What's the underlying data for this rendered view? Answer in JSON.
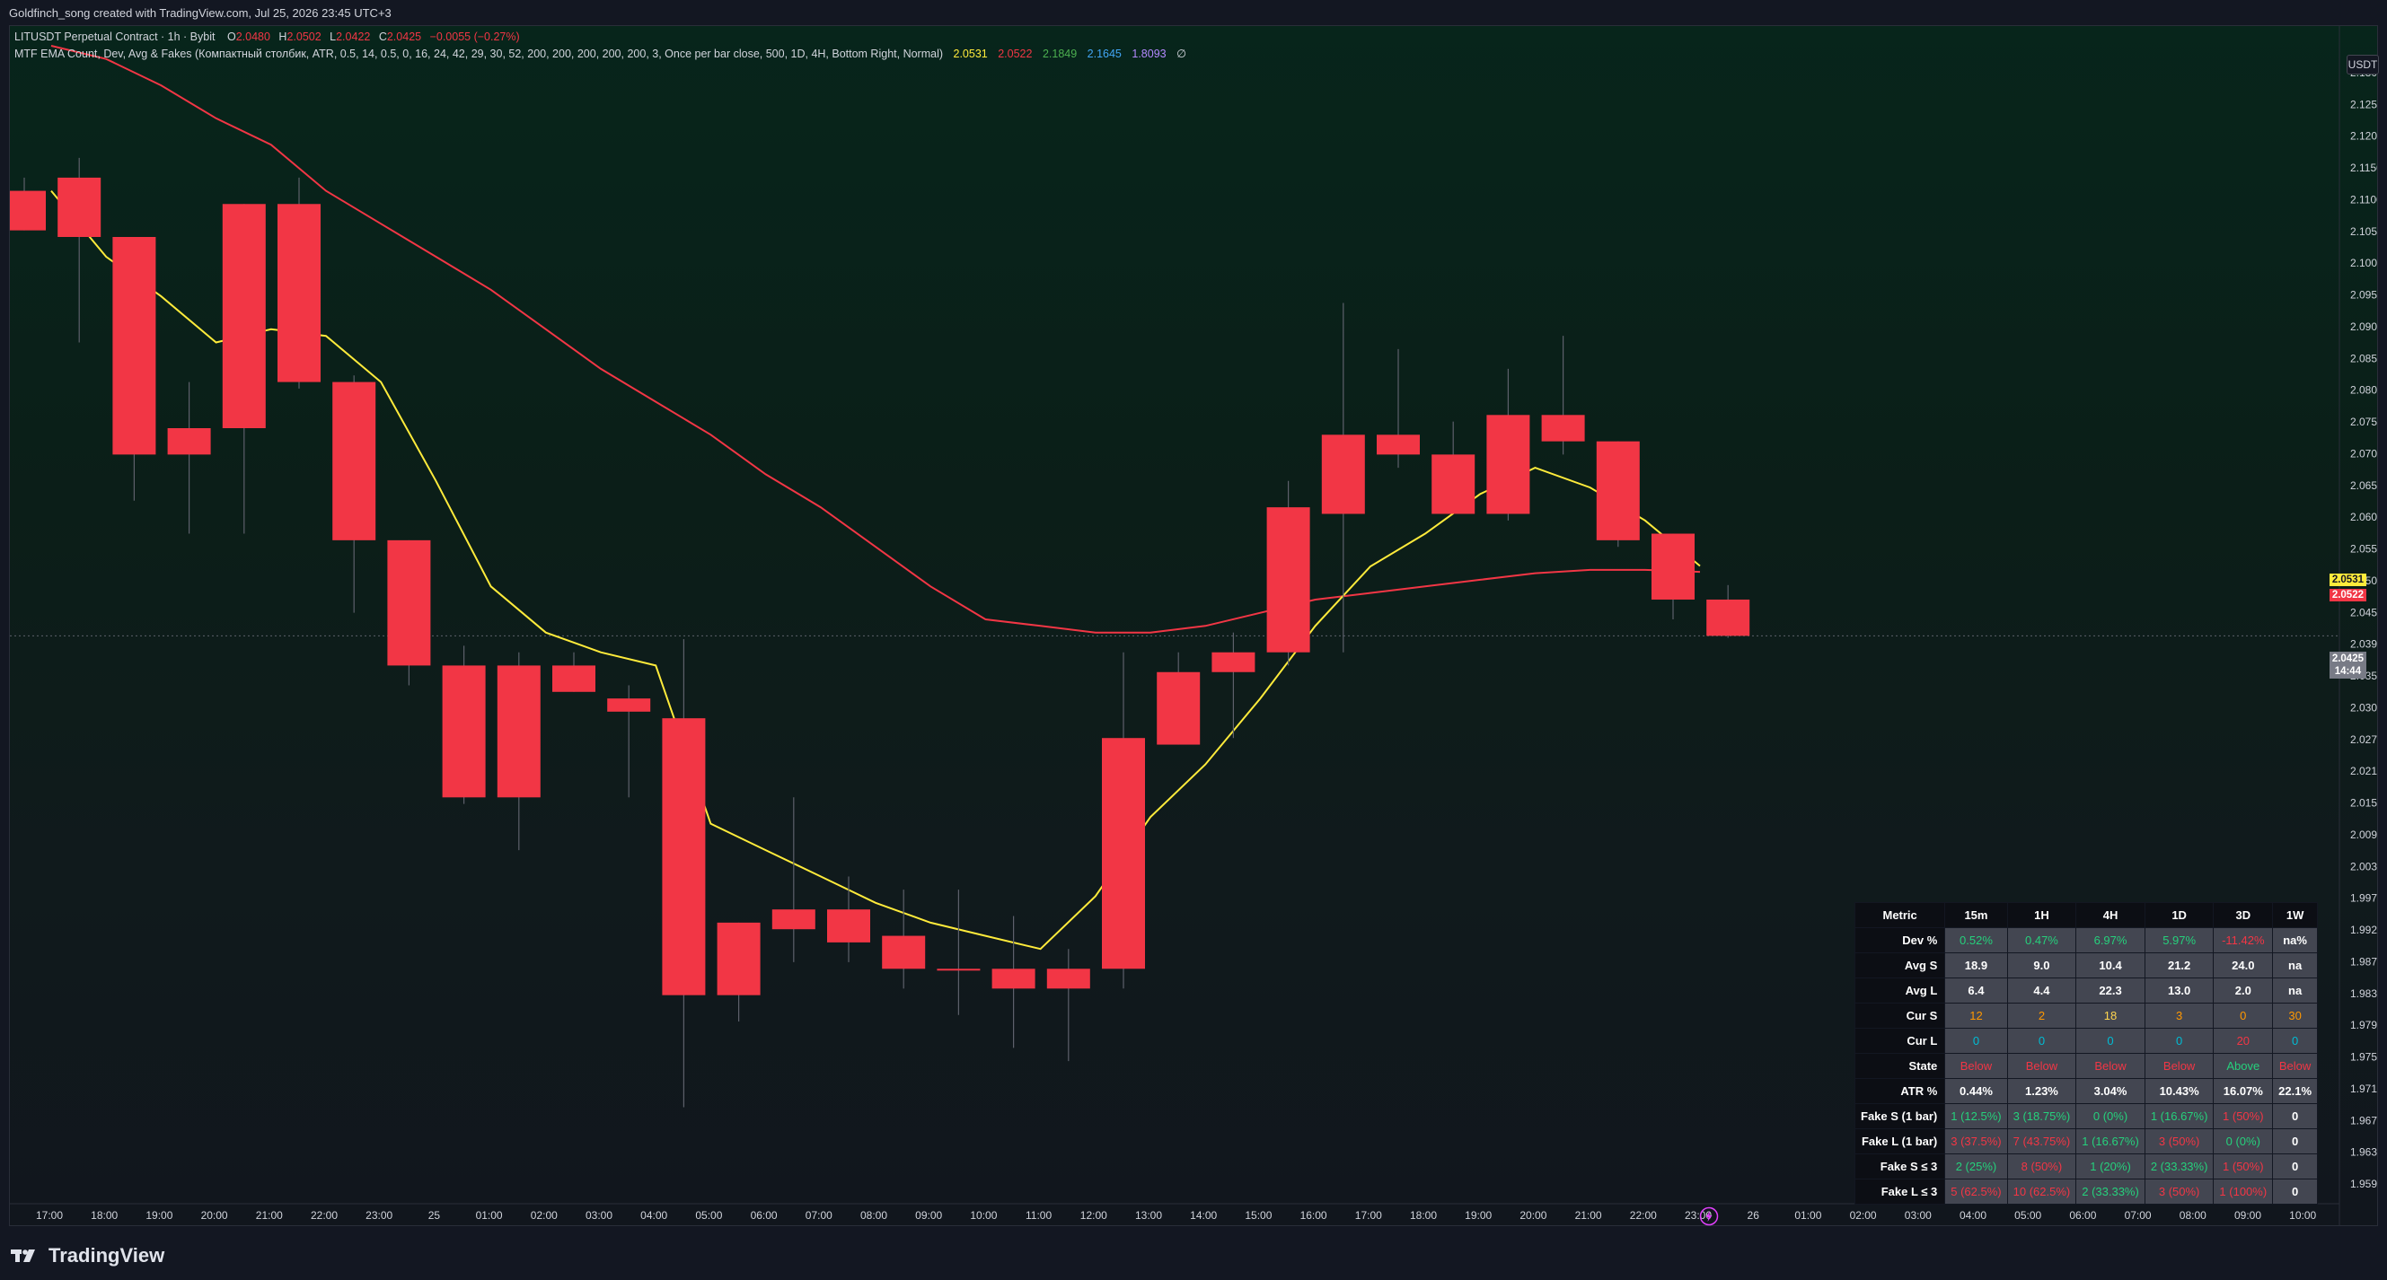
{
  "header": {
    "created_text": "Goldfinch_song created with TradingView.com, Jul 25, 2026 23:45 UTC+3"
  },
  "legend": {
    "symbol": "LITUSDT Perpetual Contract · 1h · Bybit",
    "o_label": "O",
    "o_value": "2.0480",
    "h_label": "H",
    "h_value": "2.0502",
    "l_label": "L",
    "l_value": "2.0422",
    "c_label": "C",
    "c_value": "2.0425",
    "change": "−0.0055 (−0.27%)",
    "indicator": "MTF EMA Count, Dev, Avg & Fakes (Компактный столбик, ATR, 0.5, 14, 0.5, 0, 16, 24, 42, 29, 30, 52, 200, 200, 200, 200, 200, 3, Once per bar close, 500, 1D, 4H, Bottom Right, Normal)",
    "values": [
      "2.0531",
      "2.0522",
      "2.1849",
      "2.1645",
      "1.8093",
      "∅"
    ],
    "value_colors": [
      "#ffeb3b",
      "#f23645",
      "#4caf50",
      "#42a5f5",
      "#b388ff",
      "#d1d4dc"
    ]
  },
  "price_axis": {
    "currency": "USDT",
    "labels": [
      "2.1300",
      "2.1250",
      "2.1200",
      "2.1150",
      "2.1100",
      "2.1050",
      "2.1000",
      "2.0950",
      "2.0900",
      "2.0850",
      "2.0800",
      "2.0750",
      "2.0700",
      "2.0650",
      "2.0600",
      "2.0550",
      "2.0500",
      "2.0450",
      "2.0390",
      "2.0350",
      "2.0300",
      "2.0270",
      "2.0210",
      "2.0150",
      "2.0090",
      "2.0030",
      "1.9970",
      "1.9920",
      "1.9870",
      "1.9830",
      "1.9790",
      "1.9750",
      "1.9710",
      "1.9670",
      "1.9630",
      "1.9590"
    ],
    "tag_yellow": "2.0531",
    "tag_red": "2.0522",
    "tag_last": "2.0425",
    "tag_countdown": "14:44"
  },
  "time_axis": {
    "labels": [
      "17:00",
      "18:00",
      "19:00",
      "20:00",
      "21:00",
      "22:00",
      "23:00",
      "25",
      "01:00",
      "02:00",
      "03:00",
      "04:00",
      "05:00",
      "06:00",
      "07:00",
      "08:00",
      "09:00",
      "10:00",
      "11:00",
      "12:00",
      "13:00",
      "14:00",
      "15:00",
      "16:00",
      "17:00",
      "18:00",
      "19:00",
      "20:00",
      "21:00",
      "22:00",
      "23:00",
      "26",
      "01:00",
      "02:00",
      "03:00",
      "04:00",
      "05:00",
      "06:00",
      "07:00",
      "08:00",
      "09:00",
      "10:00"
    ]
  },
  "chart_data": {
    "type": "candlestick",
    "interval": "1h",
    "ylim": [
      1.958,
      2.132
    ],
    "colors": {
      "up": "#f23645",
      "down": "#f23645",
      "ema_fast": "#ffeb3b",
      "ema_slow": "#f23645"
    },
    "candles": [
      {
        "o": 2.11,
        "h": 2.112,
        "l": 2.104,
        "c": 2.104
      },
      {
        "o": 2.112,
        "h": 2.115,
        "l": 2.087,
        "c": 2.103
      },
      {
        "o": 2.103,
        "h": 2.103,
        "l": 2.063,
        "c": 2.07
      },
      {
        "o": 2.07,
        "h": 2.081,
        "l": 2.058,
        "c": 2.074
      },
      {
        "o": 2.108,
        "h": 2.108,
        "l": 2.058,
        "c": 2.074
      },
      {
        "o": 2.108,
        "h": 2.112,
        "l": 2.08,
        "c": 2.081
      },
      {
        "o": 2.081,
        "h": 2.082,
        "l": 2.046,
        "c": 2.057
      },
      {
        "o": 2.057,
        "h": 2.057,
        "l": 2.035,
        "c": 2.038
      },
      {
        "o": 2.038,
        "h": 2.041,
        "l": 2.017,
        "c": 2.018
      },
      {
        "o": 2.038,
        "h": 2.04,
        "l": 2.01,
        "c": 2.018
      },
      {
        "o": 2.038,
        "h": 2.04,
        "l": 2.034,
        "c": 2.034
      },
      {
        "o": 2.033,
        "h": 2.035,
        "l": 2.018,
        "c": 2.031
      },
      {
        "o": 2.03,
        "h": 2.042,
        "l": 1.971,
        "c": 1.988
      },
      {
        "o": 1.999,
        "h": 1.999,
        "l": 1.984,
        "c": 1.988
      },
      {
        "o": 2.001,
        "h": 2.018,
        "l": 1.993,
        "c": 1.998
      },
      {
        "o": 2.001,
        "h": 2.006,
        "l": 1.993,
        "c": 1.996
      },
      {
        "o": 1.997,
        "h": 2.004,
        "l": 1.989,
        "c": 1.992
      },
      {
        "o": 1.992,
        "h": 2.004,
        "l": 1.985,
        "c": 1.992
      },
      {
        "o": 1.992,
        "h": 2.0,
        "l": 1.98,
        "c": 1.989
      },
      {
        "o": 1.992,
        "h": 1.995,
        "l": 1.978,
        "c": 1.989
      },
      {
        "o": 2.027,
        "h": 2.04,
        "l": 1.989,
        "c": 1.992
      },
      {
        "o": 2.037,
        "h": 2.04,
        "l": 2.026,
        "c": 2.026
      },
      {
        "o": 2.04,
        "h": 2.043,
        "l": 2.027,
        "c": 2.037
      },
      {
        "o": 2.062,
        "h": 2.066,
        "l": 2.038,
        "c": 2.04
      },
      {
        "o": 2.073,
        "h": 2.093,
        "l": 2.04,
        "c": 2.061
      },
      {
        "o": 2.073,
        "h": 2.086,
        "l": 2.068,
        "c": 2.07
      },
      {
        "o": 2.07,
        "h": 2.075,
        "l": 2.061,
        "c": 2.061
      },
      {
        "o": 2.076,
        "h": 2.083,
        "l": 2.06,
        "c": 2.061
      },
      {
        "o": 2.076,
        "h": 2.088,
        "l": 2.07,
        "c": 2.072
      },
      {
        "o": 2.072,
        "h": 2.072,
        "l": 2.056,
        "c": 2.057
      },
      {
        "o": 2.058,
        "h": 2.058,
        "l": 2.045,
        "c": 2.048
      },
      {
        "o": 2.048,
        "h": 2.0502,
        "l": 2.0422,
        "c": 2.0425
      }
    ],
    "ema_fast": [
      2.11,
      2.1,
      2.094,
      2.087,
      2.089,
      2.088,
      2.081,
      2.066,
      2.05,
      2.043,
      2.04,
      2.038,
      2.014,
      2.01,
      2.006,
      2.002,
      1.999,
      1.997,
      1.995,
      2.003,
      2.015,
      2.023,
      2.033,
      2.044,
      2.053,
      2.058,
      2.064,
      2.068,
      2.065,
      2.06,
      2.0531
    ],
    "ema_slow": [
      2.132,
      2.13,
      2.126,
      2.121,
      2.117,
      2.11,
      2.105,
      2.1,
      2.095,
      2.089,
      2.083,
      2.078,
      2.073,
      2.067,
      2.062,
      2.056,
      2.05,
      2.045,
      2.044,
      2.043,
      2.043,
      2.044,
      2.046,
      2.048,
      2.049,
      2.05,
      2.051,
      2.052,
      2.0525,
      2.0525,
      2.0522
    ]
  },
  "table": {
    "headers": [
      "Metric",
      "15m",
      "1H",
      "4H",
      "1D",
      "3D",
      "1W"
    ],
    "rows": [
      {
        "label": "Dev %",
        "cells": [
          {
            "t": "0.52%",
            "c": "cg"
          },
          {
            "t": "0.47%",
            "c": "cg"
          },
          {
            "t": "6.97%",
            "c": "cg"
          },
          {
            "t": "5.97%",
            "c": "cg"
          },
          {
            "t": "-11.42%",
            "c": "cr"
          },
          {
            "t": "na%",
            "c": "cw"
          }
        ]
      },
      {
        "label": "Avg S",
        "cells": [
          {
            "t": "18.9",
            "c": "cw"
          },
          {
            "t": "9.0",
            "c": "cw"
          },
          {
            "t": "10.4",
            "c": "cw"
          },
          {
            "t": "21.2",
            "c": "cw"
          },
          {
            "t": "24.0",
            "c": "cw"
          },
          {
            "t": "na",
            "c": "cw"
          }
        ]
      },
      {
        "label": "Avg L",
        "cells": [
          {
            "t": "6.4",
            "c": "cw"
          },
          {
            "t": "4.4",
            "c": "cw"
          },
          {
            "t": "22.3",
            "c": "cw"
          },
          {
            "t": "13.0",
            "c": "cw"
          },
          {
            "t": "2.0",
            "c": "cw"
          },
          {
            "t": "na",
            "c": "cw"
          }
        ]
      },
      {
        "label": "Cur S",
        "cells": [
          {
            "t": "12",
            "c": "co"
          },
          {
            "t": "2",
            "c": "co"
          },
          {
            "t": "18",
            "c": "cy"
          },
          {
            "t": "3",
            "c": "co"
          },
          {
            "t": "0",
            "c": "co"
          },
          {
            "t": "30",
            "c": "co"
          }
        ]
      },
      {
        "label": "Cur L",
        "cells": [
          {
            "t": "0",
            "c": "cb"
          },
          {
            "t": "0",
            "c": "cb"
          },
          {
            "t": "0",
            "c": "cb"
          },
          {
            "t": "0",
            "c": "cb"
          },
          {
            "t": "20",
            "c": "cr"
          },
          {
            "t": "0",
            "c": "cb"
          }
        ]
      },
      {
        "label": "State",
        "cells": [
          {
            "t": "Below",
            "c": "cr"
          },
          {
            "t": "Below",
            "c": "cr"
          },
          {
            "t": "Below",
            "c": "cr"
          },
          {
            "t": "Below",
            "c": "cr"
          },
          {
            "t": "Above",
            "c": "cg"
          },
          {
            "t": "Below",
            "c": "cr"
          }
        ]
      },
      {
        "label": "ATR %",
        "cells": [
          {
            "t": "0.44%",
            "c": "cw"
          },
          {
            "t": "1.23%",
            "c": "cw"
          },
          {
            "t": "3.04%",
            "c": "cw"
          },
          {
            "t": "10.43%",
            "c": "cw"
          },
          {
            "t": "16.07%",
            "c": "cw"
          },
          {
            "t": "22.1%",
            "c": "cw"
          }
        ]
      },
      {
        "label": "Fake S (1 bar)",
        "cells": [
          {
            "t": "1 (12.5%)",
            "c": "cg"
          },
          {
            "t": "3 (18.75%)",
            "c": "cg"
          },
          {
            "t": "0 (0%)",
            "c": "cg"
          },
          {
            "t": "1 (16.67%)",
            "c": "cg"
          },
          {
            "t": "1 (50%)",
            "c": "cr"
          },
          {
            "t": "0",
            "c": "cw"
          }
        ]
      },
      {
        "label": "Fake L (1 bar)",
        "cells": [
          {
            "t": "3 (37.5%)",
            "c": "cr"
          },
          {
            "t": "7 (43.75%)",
            "c": "cr"
          },
          {
            "t": "1 (16.67%)",
            "c": "cg"
          },
          {
            "t": "3 (50%)",
            "c": "cr"
          },
          {
            "t": "0 (0%)",
            "c": "cg"
          },
          {
            "t": "0",
            "c": "cw"
          }
        ]
      },
      {
        "label": "Fake S ≤ 3",
        "cells": [
          {
            "t": "2 (25%)",
            "c": "cg"
          },
          {
            "t": "8 (50%)",
            "c": "cr"
          },
          {
            "t": "1 (20%)",
            "c": "cg"
          },
          {
            "t": "2 (33.33%)",
            "c": "cg"
          },
          {
            "t": "1 (50%)",
            "c": "cr"
          },
          {
            "t": "0",
            "c": "cw"
          }
        ]
      },
      {
        "label": "Fake L ≤ 3",
        "cells": [
          {
            "t": "5 (62.5%)",
            "c": "cr"
          },
          {
            "t": "10 (62.5%)",
            "c": "cr"
          },
          {
            "t": "2 (33.33%)",
            "c": "cg"
          },
          {
            "t": "3 (50%)",
            "c": "cr"
          },
          {
            "t": "1 (100%)",
            "c": "cr"
          },
          {
            "t": "0",
            "c": "cw"
          }
        ]
      }
    ]
  },
  "footer": {
    "brand": "TradingView",
    "logo_icon": "tradingview-logo-icon"
  }
}
